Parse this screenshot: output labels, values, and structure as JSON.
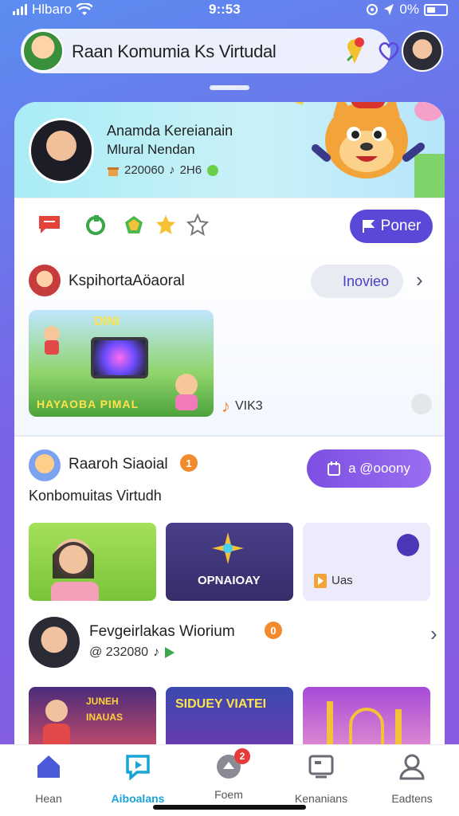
{
  "status_bar": {
    "carrier": "Hlbaro",
    "time": "9::53",
    "battery": "0%"
  },
  "header": {
    "title": "Raan Komumia Ks Virtudal"
  },
  "hero": {
    "name": "Anamda Kereianain",
    "subtitle": "Mlural Nendan",
    "stat_count": "220060",
    "stat_music": "2H6"
  },
  "actions": {
    "poner_label": "Poner"
  },
  "section1": {
    "title": "KspihortaAöaoral",
    "invite_label": "Inovieo",
    "media_top": "DINI",
    "media_bottom": "HAYAOBA PIMAL",
    "media_meta": "VIK3"
  },
  "section2": {
    "title": "Raaroh Siaoial",
    "badge": "1",
    "subtitle": "Konbomuitas Virtudh",
    "group_label": "a @ooony",
    "tile2_label": "OPNAIOAY",
    "tile3_label": "Uas"
  },
  "user_row": {
    "name": "Fevgeirlakas Wiorium",
    "badge": "0",
    "stats": "@ 232080"
  },
  "thumbs": [
    {
      "label": "JUNEH INAUAS"
    },
    {
      "label": "SIDUEY VIATEI"
    },
    {
      "label": ""
    }
  ],
  "nav": {
    "items": [
      {
        "label": "Hean"
      },
      {
        "label": "Aiboalans"
      },
      {
        "label": "Foem",
        "badge": "2"
      },
      {
        "label": "Kenanians"
      },
      {
        "label": "Eadtens"
      }
    ]
  },
  "colors": {
    "accent": "#5a48d8",
    "active_nav": "#1aa3d6",
    "badge_orange": "#f28a2e",
    "badge_red": "#e83a3a"
  }
}
